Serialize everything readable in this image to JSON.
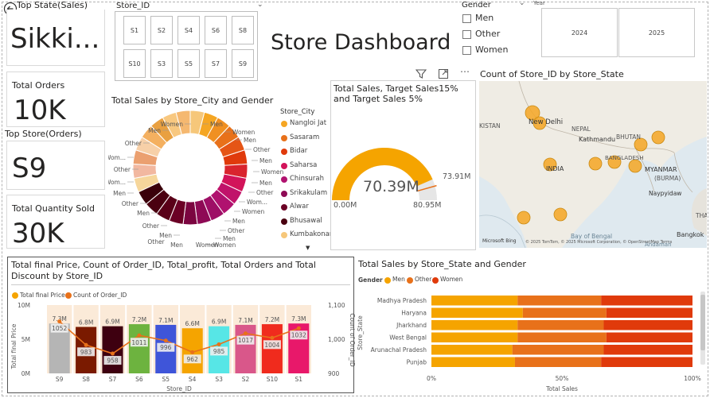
{
  "kpis": {
    "top_state_title": "Top State(Sales)",
    "top_state_value": "Sikki...",
    "total_orders_title": "Total Orders",
    "total_orders_value": "10K",
    "top_store_title": "Top Store(Orders)",
    "top_store_value": "S9",
    "total_qty_title": "Total Quantity Sold",
    "total_qty_value": "30K"
  },
  "store_slicer": {
    "title": "Store_ID",
    "items": [
      "S1",
      "S2",
      "S4",
      "S6",
      "S8",
      "S10",
      "S3",
      "S5",
      "S7",
      "S9"
    ]
  },
  "dashboard_title": "Store Dashboard",
  "gender_slicer": {
    "title": "Gender",
    "options": [
      "Men",
      "Other",
      "Women"
    ]
  },
  "year_slicer": {
    "title": "Year",
    "options": [
      "2024",
      "2025"
    ]
  },
  "toolbar_icons": [
    "filter-icon",
    "focus-mode-icon",
    "more-options-icon"
  ],
  "donut": {
    "title": "Total Sales by Store_City and Gender",
    "legend_title": "Store_City",
    "legend": [
      {
        "name": "Nangloi Jat",
        "color": "#F5A623"
      },
      {
        "name": "Sasaram",
        "color": "#E8711A"
      },
      {
        "name": "Bidar",
        "color": "#E03A0B"
      },
      {
        "name": "Saharsa",
        "color": "#D2145A"
      },
      {
        "name": "Chinsurah",
        "color": "#B0126F"
      },
      {
        "name": "Srikakulam",
        "color": "#8E0A55"
      },
      {
        "name": "Alwar",
        "color": "#6B0025"
      },
      {
        "name": "Bhusawal",
        "color": "#4A0010"
      },
      {
        "name": "Kumbakonam",
        "color": "#F6C77A"
      }
    ],
    "labels_left": [
      "Women",
      "Men",
      "Other",
      "Wom...",
      "Other",
      "Wom...",
      "Men",
      "Other",
      "Men",
      "Other",
      "Men"
    ],
    "labels_right": [
      "Men",
      "Women",
      "Men",
      "Other",
      "Men",
      "Women",
      "Men",
      "Other",
      "Wom...",
      "Women",
      "Men",
      "Other",
      "Men",
      "Women"
    ],
    "labels_bottom": [
      "Other",
      "Men",
      "Women"
    ]
  },
  "gauge": {
    "title": "Total Sales, Target Sales15% and Target Sales 5%",
    "value_label": "70.39M",
    "min_label": "0.00M",
    "max_label": "80.95M",
    "target_label": "73.91M",
    "colors": {
      "fill": "#F5A400",
      "track": "#E6E6E6",
      "target": "#E8711A"
    }
  },
  "map": {
    "title": "Count of Store_ID by Store_State",
    "labels": {
      "kistan": "KISTAN",
      "new_delhi": "New Delhi",
      "nepal": "NEPAL",
      "kathmandu": "Kathmandu",
      "bhutan": "BHUTAN",
      "india": "INDIA",
      "bangladesh": "BANGLADESH",
      "myanmar": "MYANMAR",
      "burma": "(BURMA)",
      "naypyidaw": "Naypyidaw",
      "bay": "Bay of Bengal",
      "tha": "THA",
      "bangkok": "Bangkok",
      "andaman": "Andaman"
    },
    "attribution": "© 2025 TomTom, © 2025 Microsoft Corporation, © OpenStreetMap Terms",
    "logo": "Microsoft Bing",
    "bubble_color": "#F5A623"
  },
  "combo": {
    "title": "Total final Price, Count of Order_ID, Total_profit, Total Orders and Total Discount by Store_ID",
    "legend": [
      {
        "name": "Total final Price",
        "color": "#F5A400"
      },
      {
        "name": "Count of Order_ID",
        "color": "#E8711A"
      }
    ],
    "ylabel_left": "Total final Price",
    "ylabel_right": "Count of Order_ID",
    "xlabel": "Store_ID",
    "left_ticks": [
      "10M",
      "5M",
      "0M"
    ],
    "right_ticks": [
      "1,100",
      "1,000",
      "900"
    ],
    "chart_data": {
      "type": "bar",
      "categories": [
        "S9",
        "S8",
        "S7",
        "S6",
        "S5",
        "S4",
        "S3",
        "S2",
        "S10",
        "S1"
      ],
      "series": [
        {
          "name": "Total final Price",
          "values": [
            7.3,
            6.8,
            6.9,
            7.2,
            7.1,
            6.6,
            6.9,
            7.1,
            7.2,
            7.3
          ],
          "labels": [
            "7.3M",
            "6.8M",
            "6.9M",
            "7.2M",
            "7.1M",
            "6.6M",
            "6.9M",
            "7.1M",
            "7.2M",
            "7.3M"
          ]
        },
        {
          "name": "Count of Order_ID",
          "values": [
            1052,
            983,
            958,
            1011,
            996,
            962,
            985,
            1017,
            1004,
            1032
          ]
        }
      ],
      "bar_colors": [
        "#B5B5B5",
        "#7A1A00",
        "#3E0010",
        "#6DB33F",
        "#3F55D9",
        "#F5A400",
        "#57E6E6",
        "#D9578A",
        "#F02B1D",
        "#E8186A"
      ],
      "y_left_lim": [
        0,
        10
      ],
      "y_right_lim": [
        900,
        1100
      ]
    }
  },
  "stacked": {
    "title": "Total Sales by Store_State and Gender",
    "legend_title": "Gender",
    "legend": [
      {
        "name": "Men",
        "color": "#F5A400"
      },
      {
        "name": "Other",
        "color": "#E8711A"
      },
      {
        "name": "Women",
        "color": "#E03A0B"
      }
    ],
    "ylabel": "Store_State",
    "xlabel": "Total Sales",
    "x_ticks": [
      "0%",
      "50%",
      "100%"
    ],
    "chart_data": {
      "type": "bar",
      "categories": [
        "Madhya Pradesh",
        "Haryana",
        "Jharkhand",
        "West Bengal",
        "Arunachal Pradesh",
        "Punjab"
      ],
      "series": [
        {
          "name": "Men",
          "values": [
            0.33,
            0.35,
            0.33,
            0.33,
            0.31,
            0.32
          ]
        },
        {
          "name": "Other",
          "values": [
            0.32,
            0.32,
            0.33,
            0.34,
            0.35,
            0.33
          ]
        },
        {
          "name": "Women",
          "values": [
            0.35,
            0.33,
            0.34,
            0.33,
            0.34,
            0.35
          ]
        }
      ]
    }
  }
}
